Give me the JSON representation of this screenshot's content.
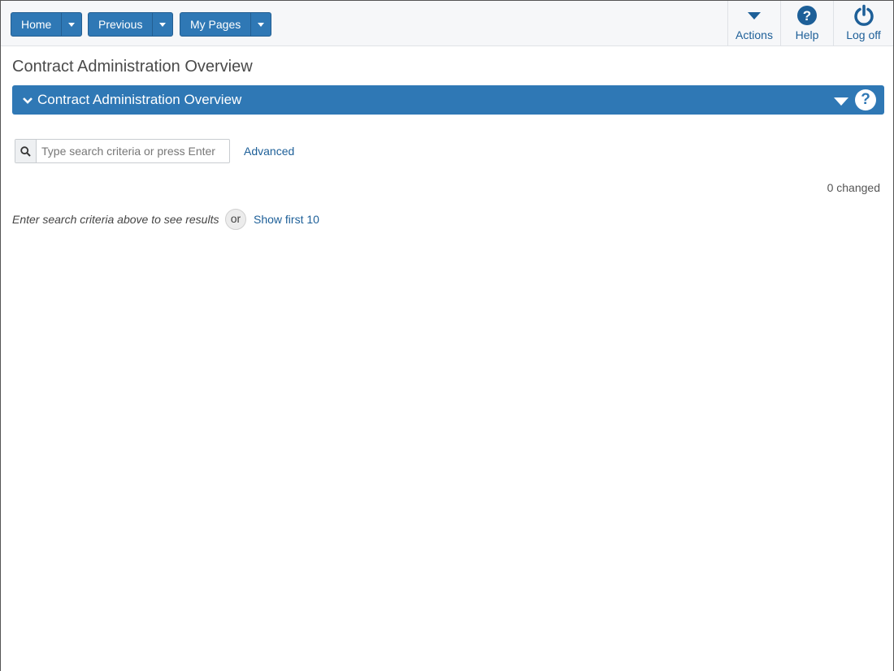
{
  "nav": {
    "home": "Home",
    "previous": "Previous",
    "my_pages": "My Pages"
  },
  "toolbar": {
    "actions": "Actions",
    "help": "Help",
    "logoff": "Log off"
  },
  "page_title": "Contract Administration Overview",
  "panel": {
    "title": "Contract Administration Overview"
  },
  "search": {
    "placeholder": "Type search criteria or press Enter",
    "value": "",
    "advanced": "Advanced"
  },
  "status": {
    "changed": "0 changed"
  },
  "results": {
    "hint": "Enter search criteria above to see results",
    "or": "or",
    "show_first": "Show first 10"
  },
  "colors": {
    "primary": "#2f78b5",
    "link": "#1d5f98"
  }
}
